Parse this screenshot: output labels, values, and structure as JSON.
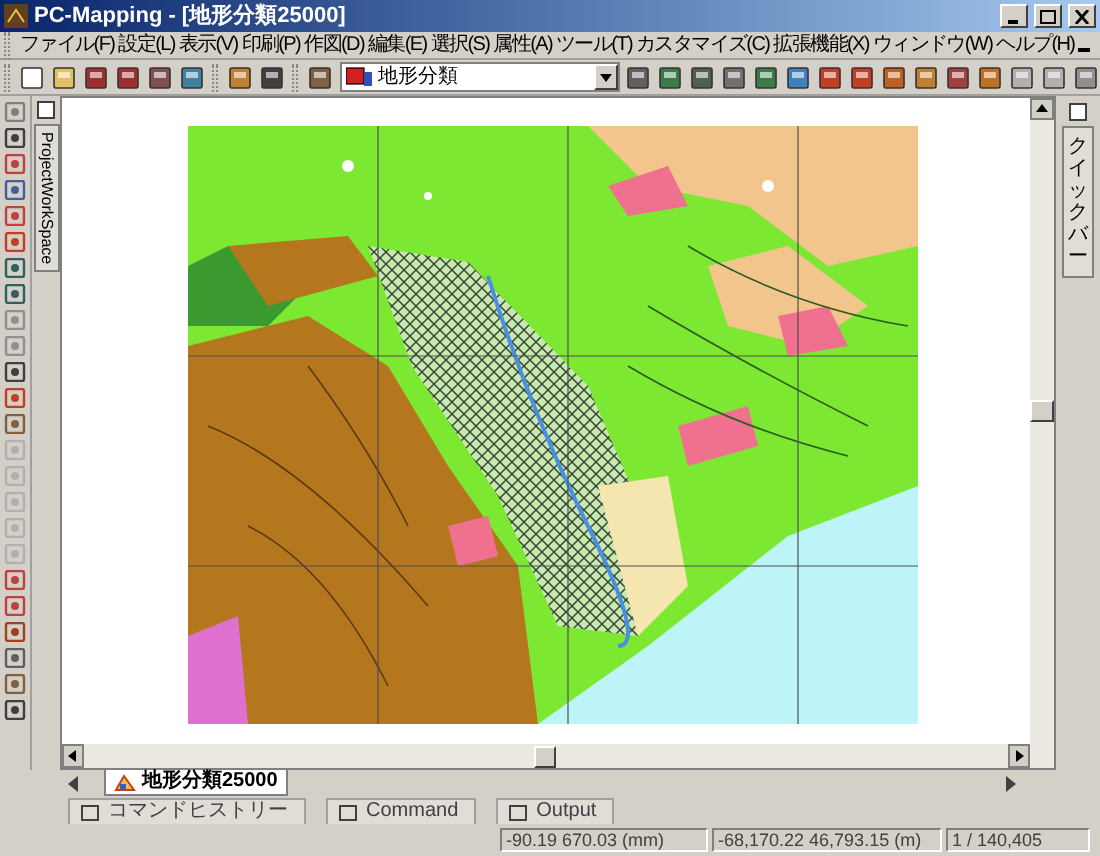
{
  "window": {
    "title": "PC-Mapping - [地形分類25000]"
  },
  "menu": [
    "ファイル(F)",
    "設定(L)",
    "表示(V)",
    "印刷(P)",
    "作図(D)",
    "編集(E)",
    "選択(S)",
    "属性(A)",
    "ツール(T)",
    "カスタマイズ(C)",
    "拡張機能(X)",
    "ウィンドウ(W)",
    "ヘルプ(H)"
  ],
  "toolbar": {
    "layer_select": {
      "value": "地形分類"
    }
  },
  "left_panel": {
    "tab": "ProjectWorkSpace"
  },
  "right_panel": {
    "tab": "クイックバー"
  },
  "document_tabs": [
    {
      "label": "地形分類25000",
      "selected": true
    }
  ],
  "bottom_tabs": [
    {
      "label": "コマンドヒストリー"
    },
    {
      "label": "Command"
    },
    {
      "label": "Output"
    }
  ],
  "status_bar": [
    "-90.19 670.03 (mm)",
    "-68,170.22 46,793.15 (m)",
    "1 / 140,405"
  ]
}
